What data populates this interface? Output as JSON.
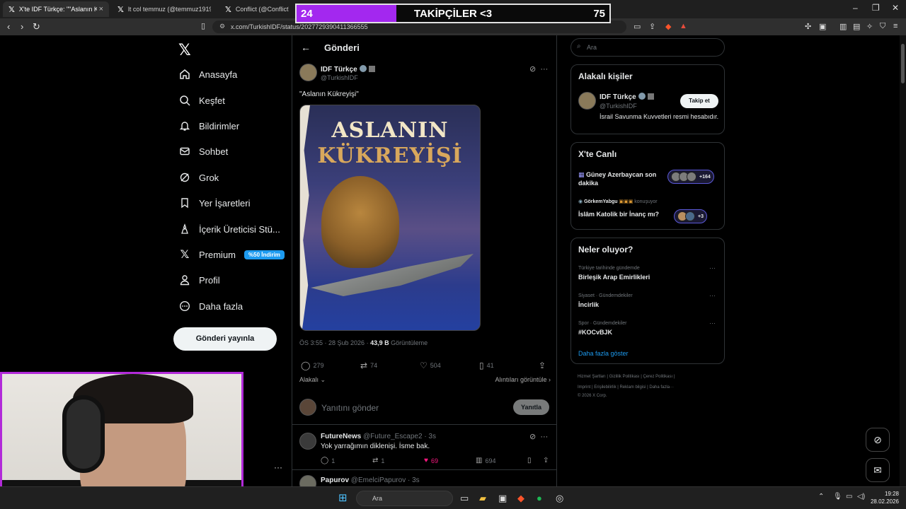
{
  "browser": {
    "tabs": [
      {
        "title": "X'te IDF Türkçe: \"\"Aslanın Kükre",
        "active": true
      },
      {
        "title": "lt col temmuz (@temmuz1919) / X",
        "active": false
      },
      {
        "title": "Conflict (@ConflictTR) / X",
        "active": false
      }
    ],
    "url": "x.com/TurkishIDF/status/2027729390411366555"
  },
  "stream_goal": {
    "current": "24",
    "label": "TAKİPÇİLER <3",
    "target": "75",
    "progress": 0.32,
    "color": "#a328ef"
  },
  "nav": {
    "items": [
      {
        "label": "Anasayfa",
        "icon": "home-icon"
      },
      {
        "label": "Keşfet",
        "icon": "search-icon"
      },
      {
        "label": "Bildirimler",
        "icon": "bell-icon"
      },
      {
        "label": "Sohbet",
        "icon": "mail-icon"
      },
      {
        "label": "Grok",
        "icon": "grok-icon"
      },
      {
        "label": "Yer İşaretleri",
        "icon": "bookmark-icon"
      },
      {
        "label": "İçerik Üreticisi Stü...",
        "icon": "creator-icon"
      },
      {
        "label": "Premium",
        "icon": "x-icon"
      },
      {
        "label": "Profil",
        "icon": "person-icon"
      },
      {
        "label": "Daha fazla",
        "icon": "more-circle-icon"
      }
    ],
    "premium_badge": "%50 İndirim",
    "post_button": "Gönderi yayınla"
  },
  "main": {
    "title": "Gönderi",
    "tweet": {
      "author": "IDF Türkçe",
      "handle": "@TurkishIDF",
      "text": "\"Aslanın Kükreyişi\"",
      "image_title_line1": "ASLANIN",
      "image_title_line2": "KÜKREYİŞİ",
      "time": "ÖS 3:55 · 28 Şub 2026 · ",
      "views": "43,9 B",
      "views_label": " Görüntüleme",
      "replies": "279",
      "retweets": "74",
      "likes": "504",
      "bookmarks": "41",
      "relevant_label": "Alakalı",
      "quotes_label": "Alıntıları görüntüle"
    },
    "reply_box": {
      "placeholder": "Yanıtını gönder",
      "button": "Yanıtla"
    },
    "replies": [
      {
        "name": "FutureNews",
        "handle": "@Future_Escape2 · 3s",
        "text": "Yok yarrağımın diklenişi. İsme bak.",
        "replies": "1",
        "retweets": "1",
        "likes": "69",
        "views": "694"
      },
      {
        "name": "Papurov",
        "handle": "@EmelciPapurov · 3s"
      }
    ]
  },
  "right": {
    "search_placeholder": "Ara",
    "relevant_people": {
      "title": "Alakalı kişiler",
      "name": "IDF Türkçe",
      "handle": "@TurkishIDF",
      "bio": "İsrail Savunma Kuvvetleri resmi hesabıdır.",
      "follow_button": "Takip et"
    },
    "live": {
      "title": "X'te Canlı",
      "items": [
        {
          "title": "Güney Azerbaycan son dakika",
          "count": "+164"
        },
        {
          "host": "GörkemYabgu",
          "host_suffix": " konuşuyor",
          "title": "İslâm Katolik bir İnanç mı?",
          "count": "+3"
        }
      ]
    },
    "trends": {
      "title": "Neler oluyor?",
      "items": [
        {
          "context": "Türkiye tarihinde gündemde",
          "name": "Birleşik Arap Emirlikleri"
        },
        {
          "context": "Siyaset · Gündemdekiler",
          "name": "İncirlik"
        },
        {
          "context": "Spor · Gündemdekiler",
          "name": "#KOCvBJK"
        }
      ],
      "show_more": "Daha fazla göster"
    },
    "footer": {
      "line1": "Hizmet Şartları  |  Gizlilik Politikası  |  Çerez Politikası  |",
      "line2": "Imprint  |  Erişilebilirlik  |  Reklam bilgisi  |  Daha fazla···",
      "line3": "© 2026 X Corp."
    }
  },
  "taskbar": {
    "search_placeholder": "Ara",
    "time": "19:28",
    "date": "28.02.2026"
  }
}
